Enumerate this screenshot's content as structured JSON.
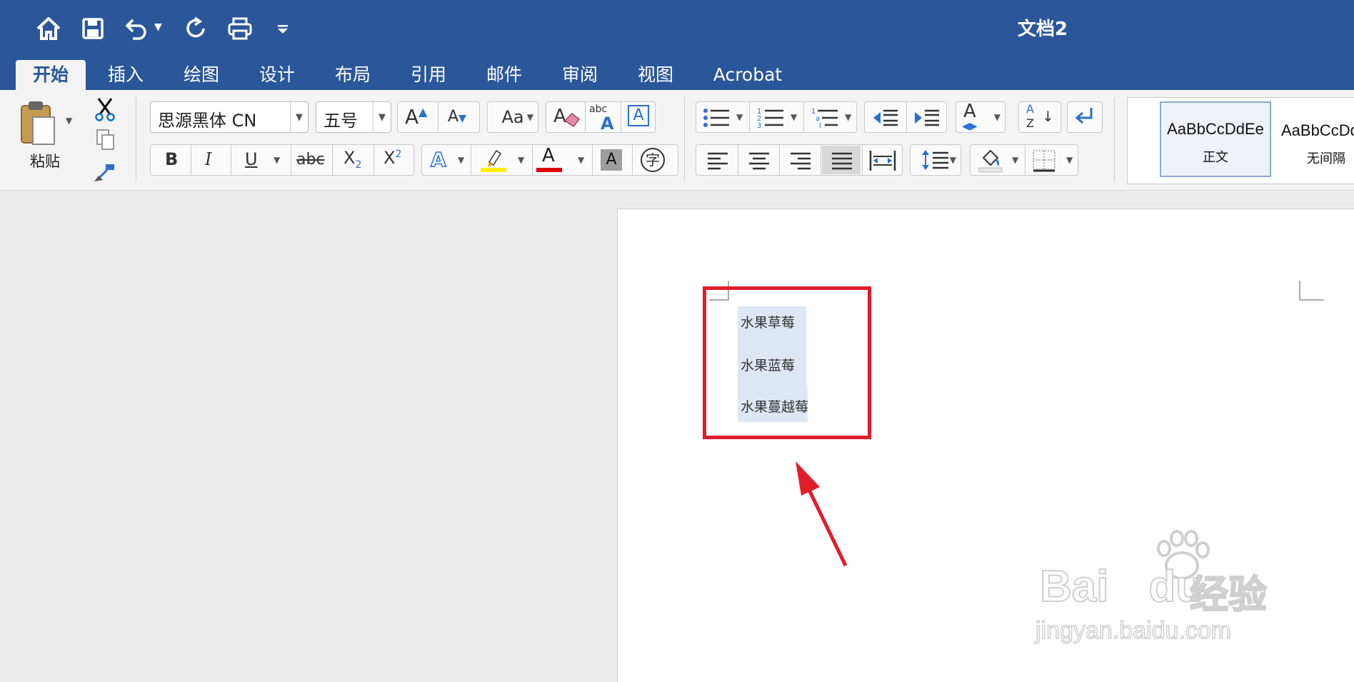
{
  "window": {
    "title": "文档2"
  },
  "quick_access": {
    "icons": [
      "home-icon",
      "save-icon",
      "undo-icon",
      "redo-icon",
      "print-icon",
      "customize-icon"
    ]
  },
  "tabs": [
    {
      "label": "开始",
      "active": true
    },
    {
      "label": "插入"
    },
    {
      "label": "绘图"
    },
    {
      "label": "设计"
    },
    {
      "label": "布局"
    },
    {
      "label": "引用"
    },
    {
      "label": "邮件"
    },
    {
      "label": "审阅"
    },
    {
      "label": "视图"
    },
    {
      "label": "Acrobat"
    }
  ],
  "clipboard": {
    "paste_label": "粘贴"
  },
  "font": {
    "name": "思源黑体 CN",
    "size": "五号",
    "bold": "B",
    "italic": "I",
    "underline": "U",
    "strike": "abc",
    "subscript": "X",
    "subscript_mark": "2",
    "superscript": "X",
    "superscript_mark": "2",
    "grow_letter": "A",
    "shrink_letter": "A",
    "case_letters": "Aa",
    "effect_letter": "A",
    "color_letter": "A",
    "shading_letter": "A",
    "phonetic_label": "字",
    "spell_label": "abc",
    "spell_letter": "A",
    "box_letter": "A",
    "highlight_color": "#ffee00",
    "font_color": "#e00000"
  },
  "paragraph": {
    "sort_a": "A",
    "sort_z": "Z",
    "style_letter": "A"
  },
  "styles": [
    {
      "sample": "AaBbCcDdEe",
      "name": "正文",
      "selected": true
    },
    {
      "sample": "AaBbCcDd",
      "name": "无间隔"
    }
  ],
  "document": {
    "lines": [
      "水果草莓",
      "水果蓝莓",
      "水果蔓越莓"
    ]
  },
  "watermark": {
    "brand": "Bai",
    "brand2": "du",
    "cn": "经验",
    "url": "jingyan.baidu.com"
  },
  "colors": {
    "accent": "#2b579a",
    "callout": "#e11d2a"
  }
}
